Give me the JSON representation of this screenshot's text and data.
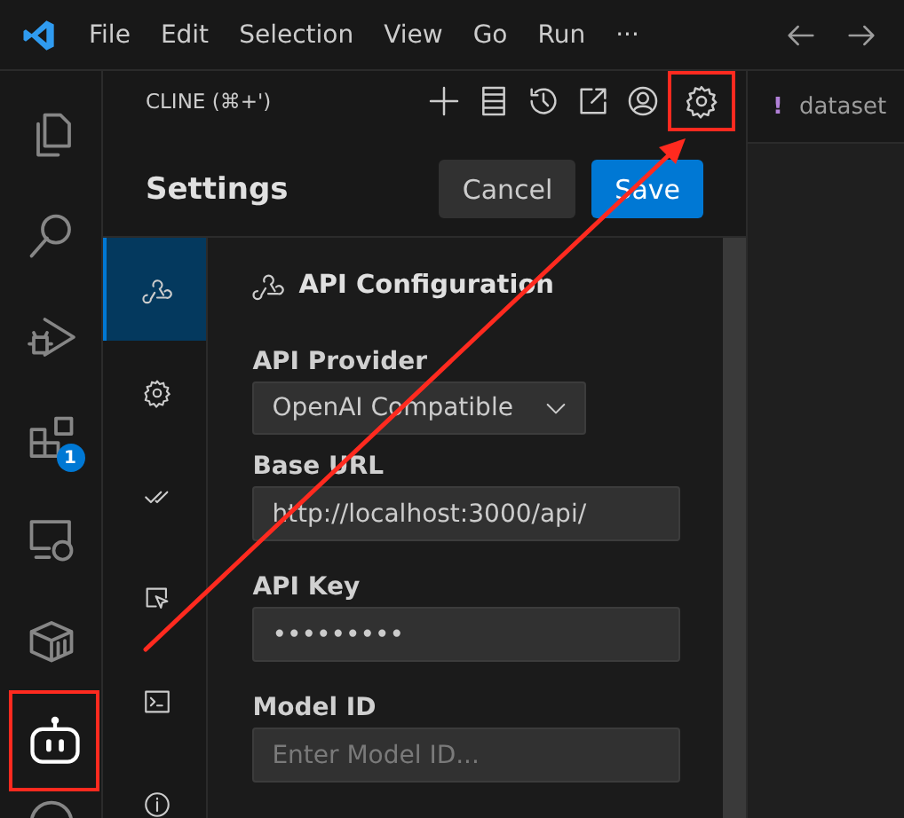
{
  "menu_bar": {
    "items": [
      "File",
      "Edit",
      "Selection",
      "View",
      "Go",
      "Run",
      "···"
    ]
  },
  "activity_bar": [
    {
      "kind": "explorer",
      "active": false,
      "highlighted": false
    },
    {
      "kind": "search",
      "active": false,
      "highlighted": false
    },
    {
      "kind": "debug",
      "active": false,
      "highlighted": false
    },
    {
      "kind": "extensions",
      "active": false,
      "highlighted": false,
      "badge": "1"
    },
    {
      "kind": "remote",
      "active": false,
      "highlighted": false
    },
    {
      "kind": "container",
      "active": false,
      "highlighted": false
    },
    {
      "kind": "robot",
      "active": true,
      "highlighted": true
    },
    {
      "kind": "circle",
      "active": false,
      "highlighted": false
    }
  ],
  "panel": {
    "title": "CLINE (⌘+')",
    "toolbar": [
      {
        "kind": "plus",
        "highlighted": false
      },
      {
        "kind": "server",
        "highlighted": false
      },
      {
        "kind": "history",
        "highlighted": false
      },
      {
        "kind": "popout",
        "highlighted": false
      },
      {
        "kind": "account",
        "highlighted": false
      },
      {
        "kind": "settings",
        "highlighted": true
      }
    ]
  },
  "settings": {
    "title": "Settings",
    "buttons": [
      {
        "label": "Cancel",
        "kind": "secondary"
      },
      {
        "label": "Save",
        "kind": "primary"
      }
    ],
    "tabs": [
      {
        "kind": "api",
        "selected": true
      },
      {
        "kind": "gear",
        "selected": false
      },
      {
        "kind": "checks",
        "selected": false
      },
      {
        "kind": "cursor",
        "selected": false
      },
      {
        "kind": "terminal",
        "selected": false
      },
      {
        "kind": "info",
        "selected": false
      }
    ],
    "section": {
      "title": "API Configuration",
      "fields": [
        {
          "kind": "select",
          "label": "API Provider",
          "value": "OpenAI Compatible"
        },
        {
          "kind": "text",
          "label": "Base URL",
          "value": "http://localhost:3000/api/"
        },
        {
          "kind": "text",
          "label": "API Key",
          "value": "•••••••••"
        },
        {
          "kind": "text",
          "label": "Model ID",
          "placeholder": "Enter Model ID..."
        }
      ]
    }
  },
  "editor": {
    "tabs": [
      {
        "mark": "!",
        "label": "dataset"
      }
    ]
  },
  "annotation_arrow": {
    "shown": true
  }
}
